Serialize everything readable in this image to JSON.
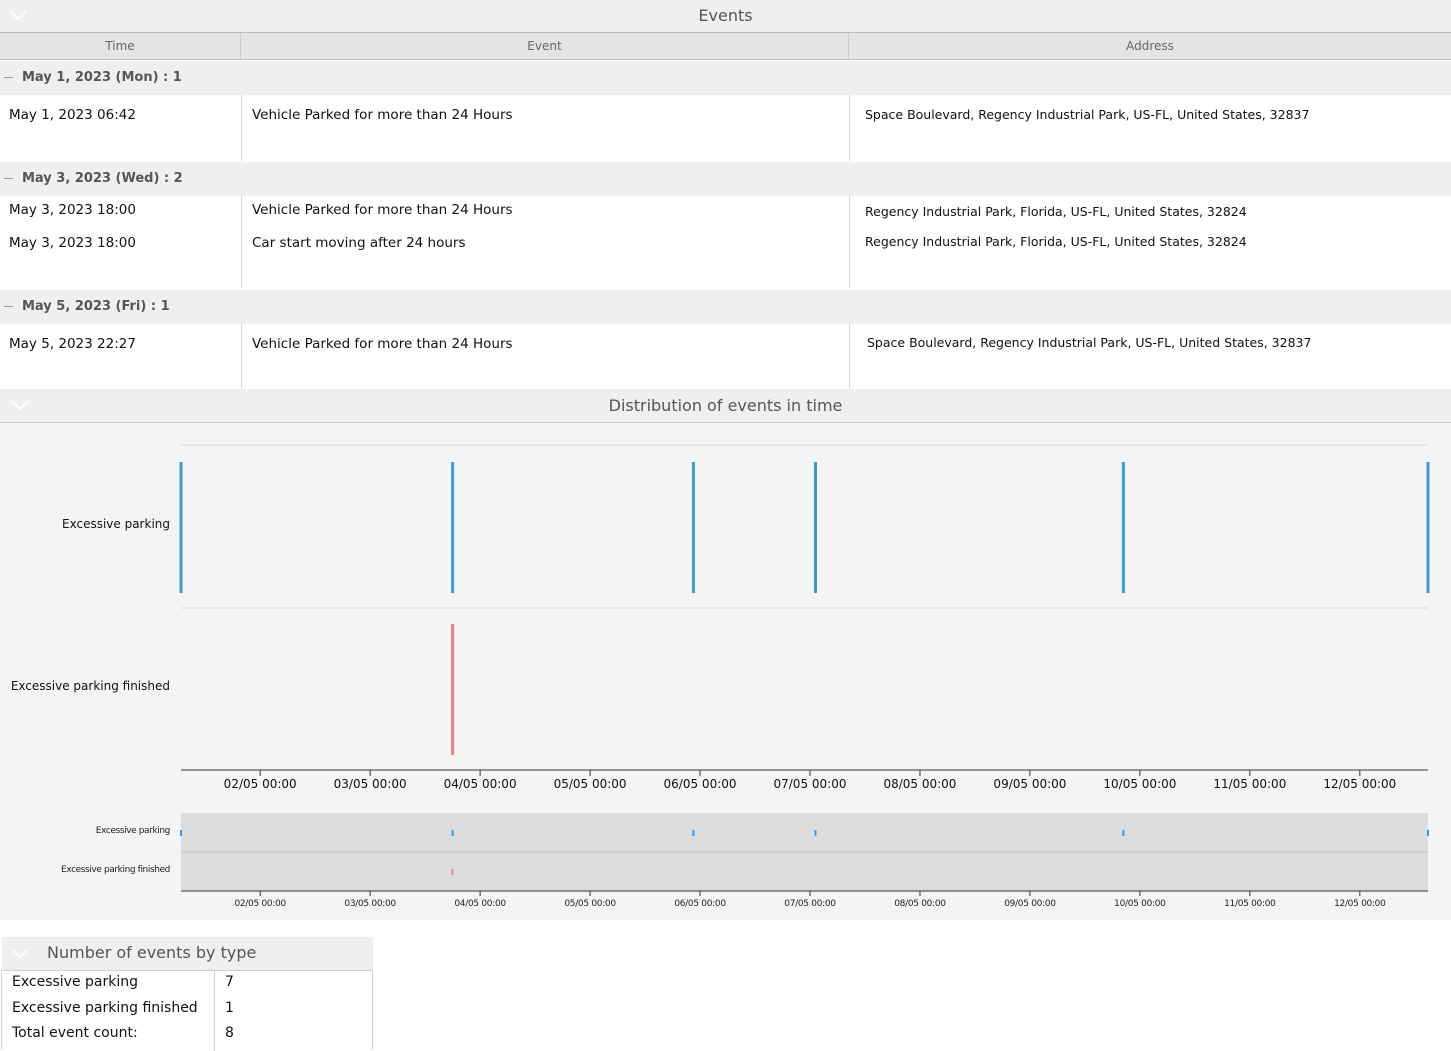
{
  "events": {
    "title": "Events",
    "columns": [
      "Time",
      "Event",
      "Address"
    ],
    "groups": [
      {
        "label": "May 1, 2023 (Mon) : 1",
        "rows": [
          {
            "time": "May 1, 2023 06:42",
            "event": "Vehicle Parked for more than 24 Hours",
            "address": "Space Boulevard, Regency Industrial Park, US-FL, United States, 32837"
          }
        ]
      },
      {
        "label": "May 3, 2023 (Wed) : 2",
        "rows": [
          {
            "time": "May 3, 2023 18:00",
            "event": "Vehicle Parked for more than 24 Hours",
            "address": "Regency Industrial Park, Florida, US-FL, United States, 32824"
          },
          {
            "time": "May 3, 2023 18:00",
            "event": "Car start moving after 24 hours",
            "address": "Regency Industrial Park, Florida, US-FL, United States, 32824"
          }
        ]
      },
      {
        "label": "May 5, 2023 (Fri) : 1",
        "rows": [
          {
            "time": "May 5, 2023 22:27",
            "event": "Vehicle Parked for more than 24 Hours",
            "address": "Space Boulevard, Regency Industrial Park, US-FL, United States, 32837"
          }
        ]
      }
    ]
  },
  "distribution": {
    "title": "Distribution of events in time",
    "lanes": [
      "Excessive parking",
      "Excessive parking finished"
    ],
    "mini_lanes": [
      "Excessive parking",
      "Excessive parking finished"
    ]
  },
  "counts": {
    "title": "Number of events by type",
    "rows": [
      {
        "label": "Excessive parking",
        "value": "7"
      },
      {
        "label": "Excessive parking finished",
        "value": "1"
      },
      {
        "label": "Total event count:",
        "value": "8"
      }
    ]
  },
  "chart_data": {
    "type": "scatter",
    "x_unit": "days (May 2023)",
    "xlim": [
      1.28,
      12.62
    ],
    "tick_labels": [
      "02/05 00:00",
      "03/05 00:00",
      "04/05 00:00",
      "05/05 00:00",
      "06/05 00:00",
      "07/05 00:00",
      "08/05 00:00",
      "09/05 00:00",
      "10/05 00:00",
      "11/05 00:00",
      "12/05 00:00"
    ],
    "tick_values": [
      2,
      3,
      4,
      5,
      6,
      7,
      8,
      9,
      10,
      11,
      12
    ],
    "series": [
      {
        "name": "Excessive parking",
        "color": "#3a9ad9",
        "x": [
          1.28,
          3.75,
          5.94,
          7.05,
          9.85,
          12.62
        ]
      },
      {
        "name": "Excessive parking finished",
        "color": "#f08080",
        "x": [
          3.75
        ]
      }
    ]
  },
  "colors": {
    "header_bg": "#efefef",
    "blue_event": "#3a9ad9",
    "red_event": "#f08080"
  }
}
